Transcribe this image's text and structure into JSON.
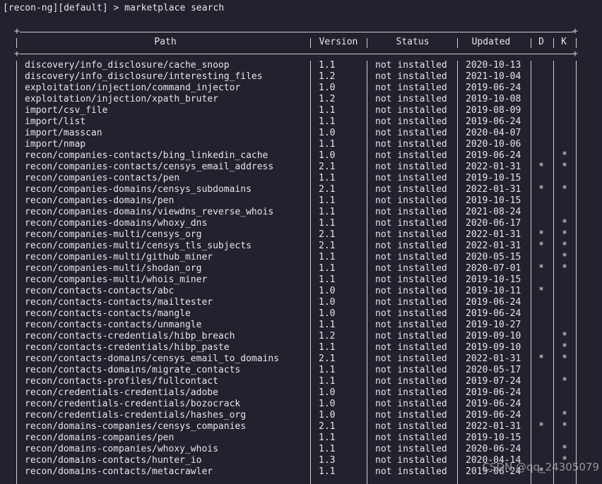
{
  "prompt": "[recon-ng][default] > marketplace search",
  "columns": {
    "path": "Path",
    "version": "Version",
    "status": "Status",
    "updated": "Updated",
    "d": "D",
    "k": "K"
  },
  "rows": [
    {
      "path": "discovery/info_disclosure/cache_snoop",
      "version": "1.1",
      "status": "not installed",
      "updated": "2020-10-13",
      "d": "",
      "k": ""
    },
    {
      "path": "discovery/info_disclosure/interesting_files",
      "version": "1.2",
      "status": "not installed",
      "updated": "2021-10-04",
      "d": "",
      "k": ""
    },
    {
      "path": "exploitation/injection/command_injector",
      "version": "1.0",
      "status": "not installed",
      "updated": "2019-06-24",
      "d": "",
      "k": ""
    },
    {
      "path": "exploitation/injection/xpath_bruter",
      "version": "1.2",
      "status": "not installed",
      "updated": "2019-10-08",
      "d": "",
      "k": ""
    },
    {
      "path": "import/csv_file",
      "version": "1.1",
      "status": "not installed",
      "updated": "2019-08-09",
      "d": "",
      "k": ""
    },
    {
      "path": "import/list",
      "version": "1.1",
      "status": "not installed",
      "updated": "2019-06-24",
      "d": "",
      "k": ""
    },
    {
      "path": "import/masscan",
      "version": "1.0",
      "status": "not installed",
      "updated": "2020-04-07",
      "d": "",
      "k": ""
    },
    {
      "path": "import/nmap",
      "version": "1.1",
      "status": "not installed",
      "updated": "2020-10-06",
      "d": "",
      "k": ""
    },
    {
      "path": "recon/companies-contacts/bing_linkedin_cache",
      "version": "1.0",
      "status": "not installed",
      "updated": "2019-06-24",
      "d": "",
      "k": "*"
    },
    {
      "path": "recon/companies-contacts/censys_email_address",
      "version": "2.1",
      "status": "not installed",
      "updated": "2022-01-31",
      "d": "*",
      "k": "*"
    },
    {
      "path": "recon/companies-contacts/pen",
      "version": "1.1",
      "status": "not installed",
      "updated": "2019-10-15",
      "d": "",
      "k": ""
    },
    {
      "path": "recon/companies-domains/censys_subdomains",
      "version": "2.1",
      "status": "not installed",
      "updated": "2022-01-31",
      "d": "*",
      "k": "*"
    },
    {
      "path": "recon/companies-domains/pen",
      "version": "1.1",
      "status": "not installed",
      "updated": "2019-10-15",
      "d": "",
      "k": ""
    },
    {
      "path": "recon/companies-domains/viewdns_reverse_whois",
      "version": "1.1",
      "status": "not installed",
      "updated": "2021-08-24",
      "d": "",
      "k": ""
    },
    {
      "path": "recon/companies-domains/whoxy_dns",
      "version": "1.1",
      "status": "not installed",
      "updated": "2020-06-17",
      "d": "",
      "k": "*"
    },
    {
      "path": "recon/companies-multi/censys_org",
      "version": "2.1",
      "status": "not installed",
      "updated": "2022-01-31",
      "d": "*",
      "k": "*"
    },
    {
      "path": "recon/companies-multi/censys_tls_subjects",
      "version": "2.1",
      "status": "not installed",
      "updated": "2022-01-31",
      "d": "*",
      "k": "*"
    },
    {
      "path": "recon/companies-multi/github_miner",
      "version": "1.1",
      "status": "not installed",
      "updated": "2020-05-15",
      "d": "",
      "k": "*"
    },
    {
      "path": "recon/companies-multi/shodan_org",
      "version": "1.1",
      "status": "not installed",
      "updated": "2020-07-01",
      "d": "*",
      "k": "*"
    },
    {
      "path": "recon/companies-multi/whois_miner",
      "version": "1.1",
      "status": "not installed",
      "updated": "2019-10-15",
      "d": "",
      "k": ""
    },
    {
      "path": "recon/contacts-contacts/abc",
      "version": "1.0",
      "status": "not installed",
      "updated": "2019-10-11",
      "d": "*",
      "k": ""
    },
    {
      "path": "recon/contacts-contacts/mailtester",
      "version": "1.0",
      "status": "not installed",
      "updated": "2019-06-24",
      "d": "",
      "k": ""
    },
    {
      "path": "recon/contacts-contacts/mangle",
      "version": "1.0",
      "status": "not installed",
      "updated": "2019-06-24",
      "d": "",
      "k": ""
    },
    {
      "path": "recon/contacts-contacts/unmangle",
      "version": "1.1",
      "status": "not installed",
      "updated": "2019-10-27",
      "d": "",
      "k": ""
    },
    {
      "path": "recon/contacts-credentials/hibp_breach",
      "version": "1.2",
      "status": "not installed",
      "updated": "2019-09-10",
      "d": "",
      "k": "*"
    },
    {
      "path": "recon/contacts-credentials/hibp_paste",
      "version": "1.1",
      "status": "not installed",
      "updated": "2019-09-10",
      "d": "",
      "k": "*"
    },
    {
      "path": "recon/contacts-domains/censys_email_to_domains",
      "version": "2.1",
      "status": "not installed",
      "updated": "2022-01-31",
      "d": "*",
      "k": "*"
    },
    {
      "path": "recon/contacts-domains/migrate_contacts",
      "version": "1.1",
      "status": "not installed",
      "updated": "2020-05-17",
      "d": "",
      "k": ""
    },
    {
      "path": "recon/contacts-profiles/fullcontact",
      "version": "1.1",
      "status": "not installed",
      "updated": "2019-07-24",
      "d": "",
      "k": "*"
    },
    {
      "path": "recon/credentials-credentials/adobe",
      "version": "1.0",
      "status": "not installed",
      "updated": "2019-06-24",
      "d": "",
      "k": ""
    },
    {
      "path": "recon/credentials-credentials/bozocrack",
      "version": "1.0",
      "status": "not installed",
      "updated": "2019-06-24",
      "d": "",
      "k": ""
    },
    {
      "path": "recon/credentials-credentials/hashes_org",
      "version": "1.0",
      "status": "not installed",
      "updated": "2019-06-24",
      "d": "",
      "k": "*"
    },
    {
      "path": "recon/domains-companies/censys_companies",
      "version": "2.1",
      "status": "not installed",
      "updated": "2022-01-31",
      "d": "*",
      "k": "*"
    },
    {
      "path": "recon/domains-companies/pen",
      "version": "1.1",
      "status": "not installed",
      "updated": "2019-10-15",
      "d": "",
      "k": ""
    },
    {
      "path": "recon/domains-companies/whoxy_whois",
      "version": "1.1",
      "status": "not installed",
      "updated": "2020-06-24",
      "d": "",
      "k": "*"
    },
    {
      "path": "recon/domains-contacts/hunter_io",
      "version": "1.3",
      "status": "not installed",
      "updated": "2020-04-14",
      "d": "",
      "k": "*"
    },
    {
      "path": "recon/domains-contacts/metacrawler",
      "version": "1.1",
      "status": "not installed",
      "updated": "2019-06-24",
      "d": "*",
      "k": ""
    }
  ],
  "watermark": "CSDN @qq_24305079"
}
